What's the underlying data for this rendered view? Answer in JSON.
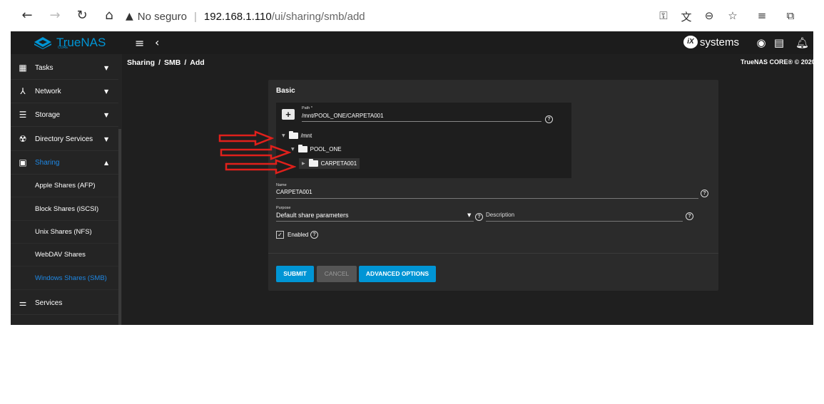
{
  "browser": {
    "insecure_label": "No seguro",
    "url_host": "192.168.1.110",
    "url_path": "/ui/sharing/smb/add"
  },
  "app": {
    "logo_name": "TrueNAS",
    "logo_sub": "CORE",
    "vendor": "systems",
    "vendor_mark": "iX",
    "copyright": "TrueNAS CORE® © 2020"
  },
  "sidebar": {
    "items": [
      {
        "label": "Tasks",
        "icon": "calendar-icon"
      },
      {
        "label": "Network",
        "icon": "network-icon"
      },
      {
        "label": "Storage",
        "icon": "storage-icon"
      },
      {
        "label": "Directory Services",
        "icon": "directory-icon"
      },
      {
        "label": "Sharing",
        "icon": "sharing-icon"
      },
      {
        "label": "Services",
        "icon": "services-icon"
      }
    ],
    "sub_items": [
      {
        "label": "Apple Shares (AFP)"
      },
      {
        "label": "Block Shares (iSCSI)"
      },
      {
        "label": "Unix Shares (NFS)"
      },
      {
        "label": "WebDAV Shares"
      },
      {
        "label": "Windows Shares (SMB)"
      }
    ]
  },
  "breadcrumb": {
    "sharing": "Sharing",
    "smb": "SMB",
    "add": "Add"
  },
  "form": {
    "section_title": "Basic",
    "path_label": "Path *",
    "path_value": "/mnt/POOL_ONE/CARPETA001",
    "tree": {
      "root": "/mnt",
      "pool": "POOL_ONE",
      "folder": "CARPETA001"
    },
    "name_label": "Name",
    "name_value": "CARPETA001",
    "purpose_label": "Purpose",
    "purpose_value": "Default share parameters",
    "description_placeholder": "Description",
    "enabled_label": "Enabled",
    "submit_label": "SUBMIT",
    "cancel_label": "CANCEL",
    "advanced_label": "ADVANCED OPTIONS"
  },
  "colors": {
    "accent": "#0095d5",
    "arrow": "#e0201b"
  }
}
